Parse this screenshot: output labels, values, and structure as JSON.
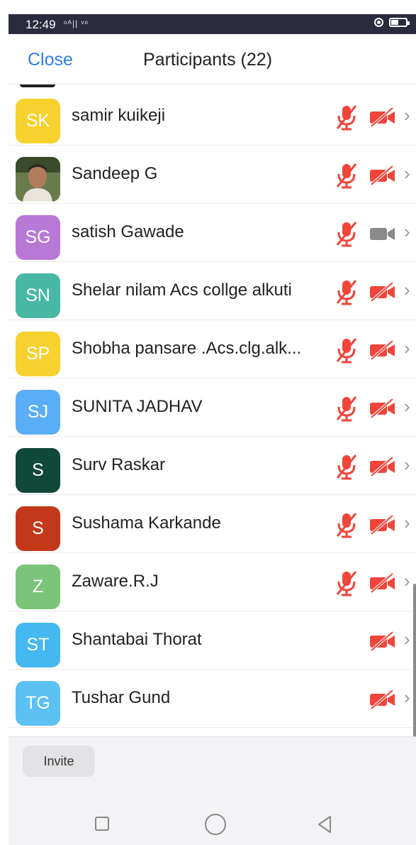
{
  "status_bar": {
    "time": "12:49",
    "signal": "ᵒᴬ|| ᵛᵒ"
  },
  "header": {
    "close_label": "Close",
    "title": "Participants (22)"
  },
  "participants": [
    {
      "initials": "SK",
      "name": "samir kuikeji",
      "avatar_color": "#f7d12e",
      "mic": "muted",
      "video": "off"
    },
    {
      "initials": "",
      "name": "Sandeep G",
      "avatar_color": "photo",
      "mic": "muted",
      "video": "off"
    },
    {
      "initials": "SG",
      "name": "satish Gawade",
      "avatar_color": "#b879d6",
      "mic": "muted",
      "video": "on-gray"
    },
    {
      "initials": "SN",
      "name": "Shelar nilam Acs collge alkuti",
      "avatar_color": "#48b8a4",
      "mic": "muted",
      "video": "off"
    },
    {
      "initials": "SP",
      "name": "Shobha pansare .Acs.clg.alk...",
      "avatar_color": "#f7d12e",
      "mic": "muted",
      "video": "off"
    },
    {
      "initials": "SJ",
      "name": "SUNITA JADHAV",
      "avatar_color": "#5aaef5",
      "mic": "muted",
      "video": "off"
    },
    {
      "initials": "S",
      "name": "Surv Raskar",
      "avatar_color": "#10483a",
      "mic": "muted",
      "video": "off"
    },
    {
      "initials": "S",
      "name": "Sushama Karkande",
      "avatar_color": "#c2391a",
      "mic": "muted",
      "video": "off"
    },
    {
      "initials": "Z",
      "name": "Zaware.R.J",
      "avatar_color": "#7cc47a",
      "mic": "muted",
      "video": "off"
    },
    {
      "initials": "ST",
      "name": "Shantabai Thorat",
      "avatar_color": "#45b8f0",
      "mic": "none",
      "video": "off"
    },
    {
      "initials": "TG",
      "name": "Tushar Gund",
      "avatar_color": "#5cc0f2",
      "mic": "none",
      "video": "off"
    }
  ],
  "footer": {
    "invite_label": "Invite"
  },
  "colors": {
    "accent": "#2f7de1",
    "muted_red": "#f0453a",
    "video_gray": "#8a8a8a"
  }
}
